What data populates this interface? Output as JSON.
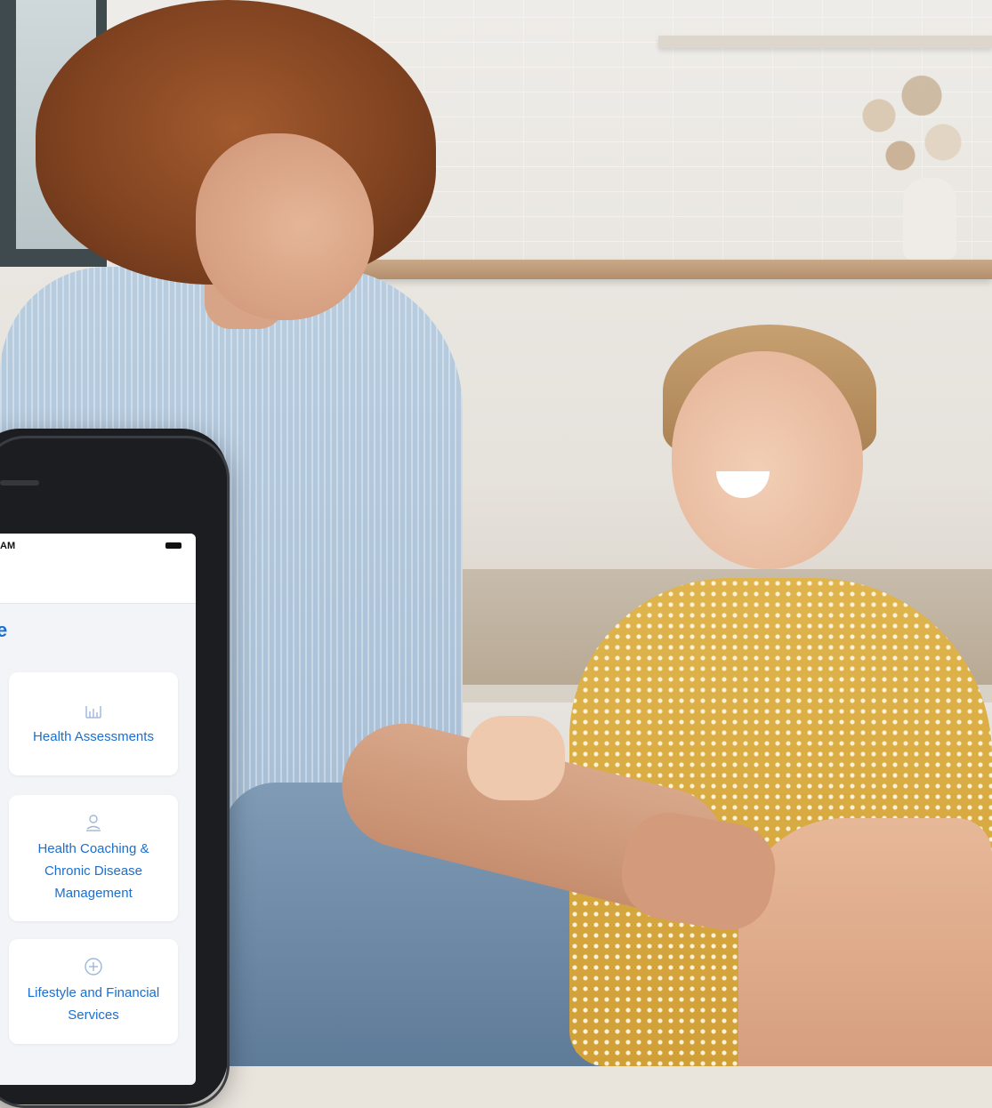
{
  "phone": {
    "status_time": "AM",
    "section_title_fragment": "e",
    "tiles": [
      {
        "label": "Health Assessments",
        "icon": "bar-chart-icon"
      },
      {
        "label": "Health Coaching & Chronic Disease Management",
        "icon": "person-coaching-icon"
      },
      {
        "label": "Lifestyle and Financial Services",
        "icon": "plus-circle-icon"
      }
    ]
  },
  "colors": {
    "accent": "#1a6fd0",
    "tile_background": "#ffffff",
    "screen_background": "#f2f4f7",
    "phone_body": "#1b1d21"
  }
}
